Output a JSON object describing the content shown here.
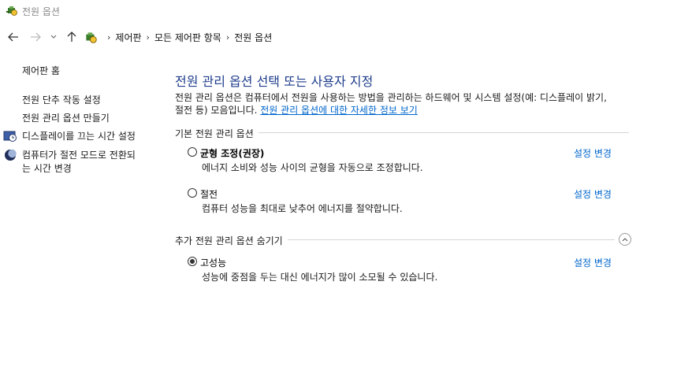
{
  "window": {
    "title": "전원 옵션"
  },
  "breadcrumb": {
    "items": [
      "제어판",
      "모든 제어판 항목",
      "전원 옵션"
    ]
  },
  "sidebar": {
    "items": [
      {
        "label": "제어판 홈"
      },
      {
        "label": "전원 단추 작동 설정"
      },
      {
        "label": "전원 관리 옵션 만들기"
      },
      {
        "label": "디스플레이를 끄는 시간 설정",
        "icon": "clock-display-icon"
      },
      {
        "label_line1": "컴퓨터가 절전 모드로 전환되",
        "label_line2": "는 시간 변경",
        "icon": "moon-sleep-icon"
      }
    ]
  },
  "main": {
    "heading": "전원 관리 옵션 선택 또는 사용자 지정",
    "desc_line1": "전원 관리 옵션은 컴퓨터에서 전원을 사용하는 방법을 관리하는 하드웨어 및 시스템 설정(예: 디스플레이 밝기,",
    "desc_line2": "절전 등) 모음입니다. ",
    "desc_link": "전원 관리 옵션에 대한 자세한 정보 보기",
    "basic_section": "기본 전원 관리 옵션",
    "extra_section": "추가 전원 관리 옵션 숨기기",
    "plans": [
      {
        "name": "균형 조정(권장)",
        "desc": "에너지 소비와 성능 사이의 균형을 자동으로 조정합니다.",
        "link": "설정 변경",
        "selected": false
      },
      {
        "name": "절전",
        "desc": "컴퓨터 성능을 최대로 낮추어 에너지를 절약합니다.",
        "link": "설정 변경",
        "selected": false
      },
      {
        "name": "고성능",
        "desc": "성능에 중점을 두는 대신 에너지가 많이 소모될 수 있습니다.",
        "link": "설정 변경",
        "selected": true
      }
    ]
  },
  "colors": {
    "heading": "#1e3c8c",
    "link": "#0066cc"
  }
}
